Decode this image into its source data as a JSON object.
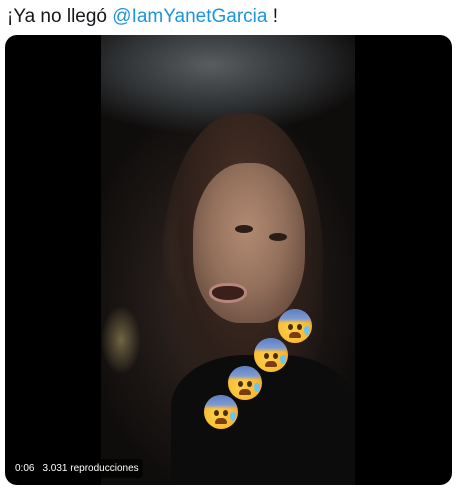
{
  "tweet": {
    "text_before": "¡Ya no llegó ",
    "mention": "@IamYanetGarcia",
    "text_after": " !"
  },
  "video": {
    "elapsed_time": "0:06",
    "view_count": "3.031 reproducciones"
  },
  "overlay": {
    "emoji_icon": "anxious-face-with-sweat-icon",
    "emoji_count": 4
  },
  "colors": {
    "mention": "#1b95e0",
    "text": "#14171a",
    "media_background": "#000000"
  }
}
